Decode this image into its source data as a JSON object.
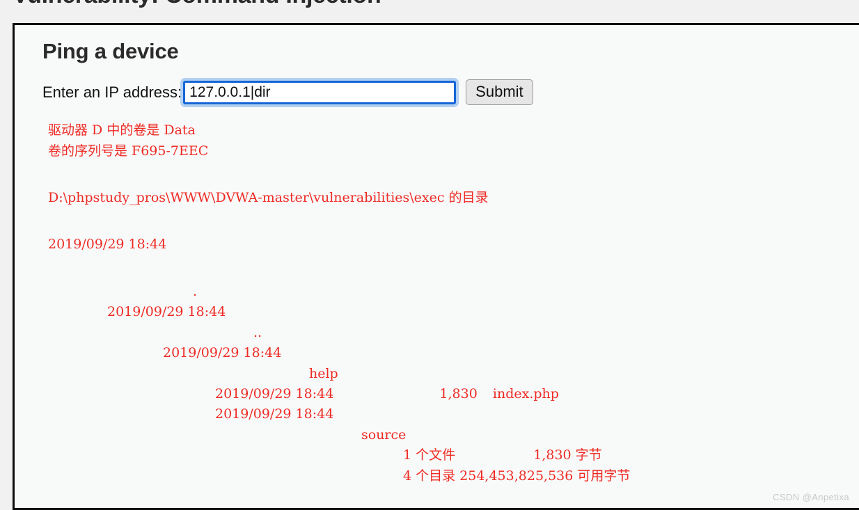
{
  "page": {
    "title": "Vulnerability: Command Injection",
    "watermark": "CSDN @Anpetixa",
    "accent_red": "#ee2b24",
    "focus_blue": "#1565d8",
    "panel_bg": "#f8f9f9",
    "page_bg": "#f1f1f1"
  },
  "form": {
    "heading": "Ping a device",
    "ip_label": "Enter an IP address:",
    "ip_value": "127.0.0.1|dir",
    "ip_placeholder": "",
    "submit_label": "Submit"
  },
  "output": {
    "volume_line": "驱动器 D 中的卷是 Data",
    "serial_line": "卷的序列号是 F695-7EEC",
    "directory_of": "D:\\phpstudy_pros\\WWW\\DVWA-master\\vulnerabilities\\exec 的目录",
    "row_root_datetime": "2019/09/29  18:44",
    "row_dot_name": ".",
    "row_dot_datetime": "2019/09/29  18:44",
    "row_dotdot_name": "..",
    "row_dotdot_datetime": "2019/09/29  18:44",
    "row_help_name": "help",
    "row_index_datetime": "2019/09/29  18:44",
    "row_index_size": "1,830",
    "row_index_name": "index.php",
    "row_source_datetime": "2019/09/29  18:44",
    "row_source_name": "source",
    "summary_files": "1 个文件",
    "summary_files_bytes": "1,830 字节",
    "summary_dirs": "4 个目录 254,453,825,536 可用字节"
  }
}
